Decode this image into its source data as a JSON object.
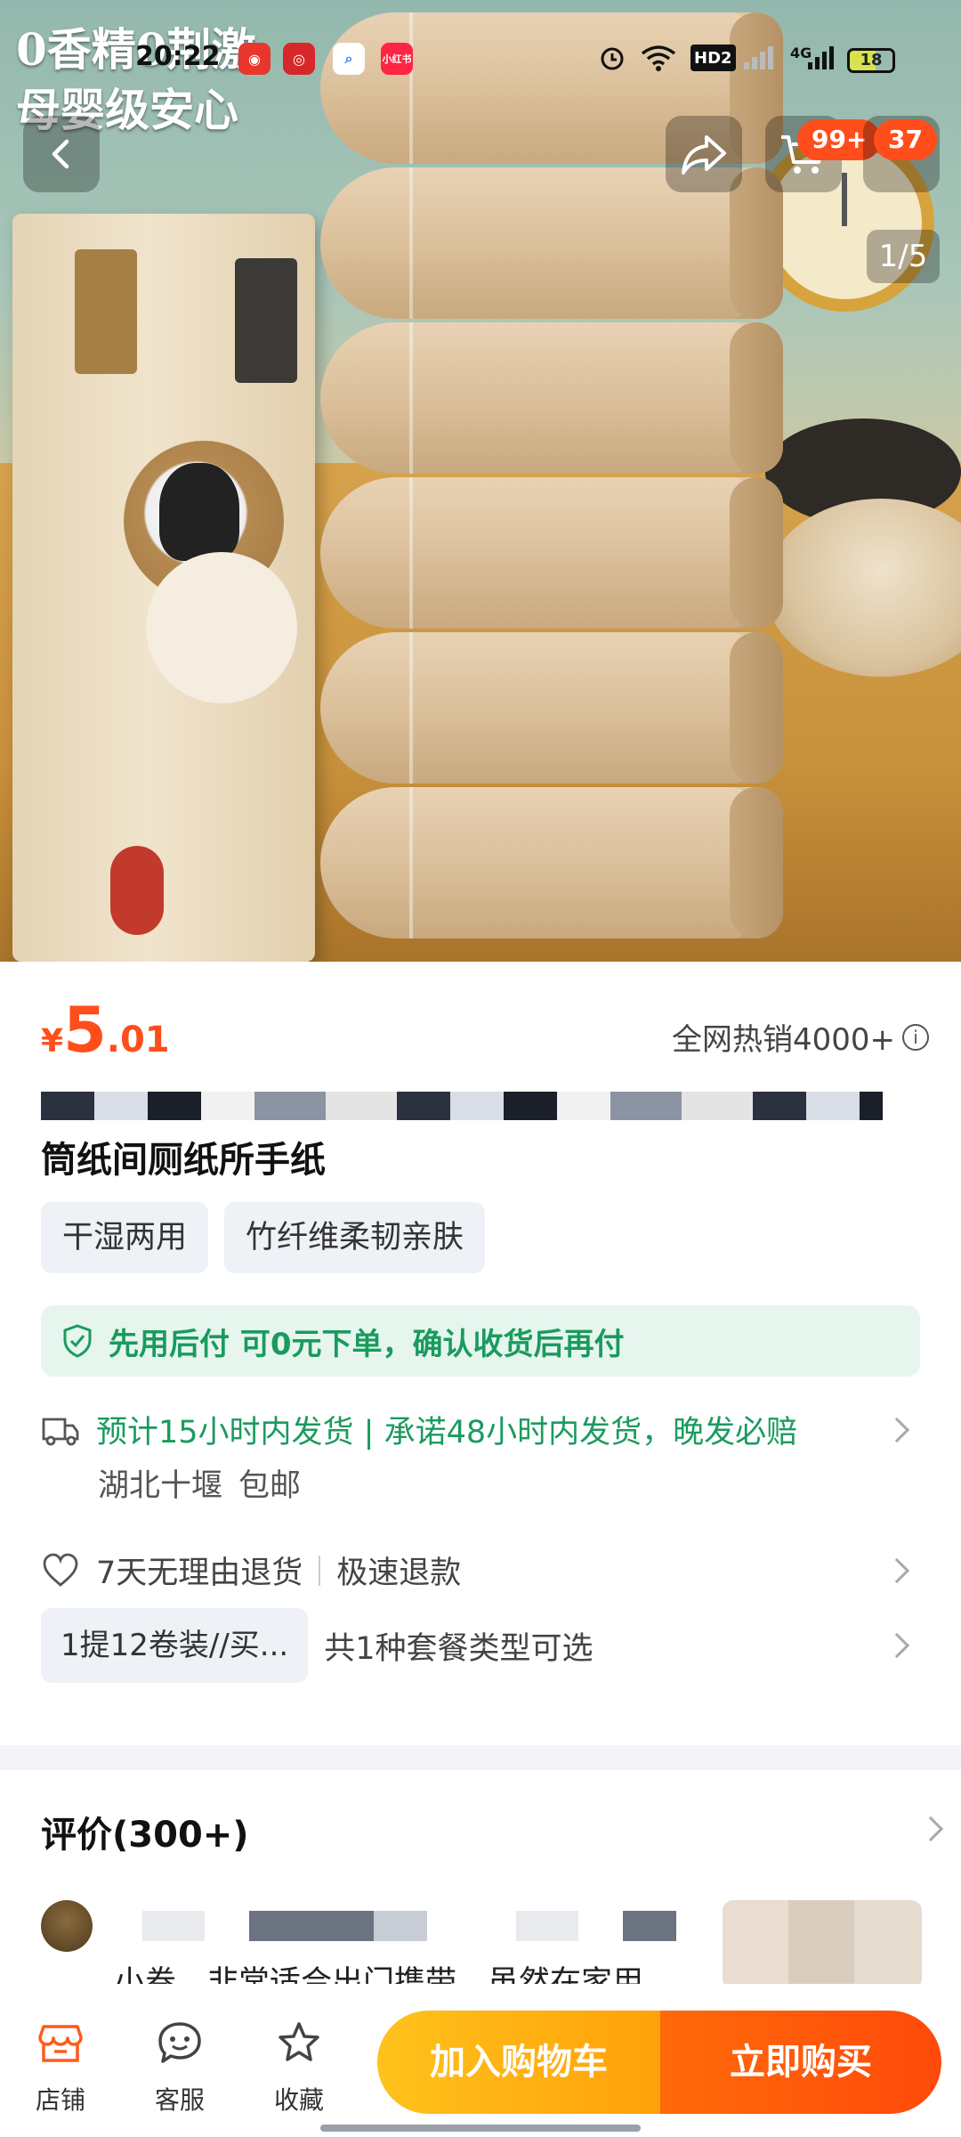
{
  "status_bar": {
    "time": "20:22",
    "app_icons": [
      "weibo-icon",
      "app-icon",
      "search-app-icon",
      "xiaohongshu-icon"
    ],
    "xiaohongshu_label": "小红书",
    "network_label": "HD2",
    "network_gen": "4G",
    "battery": "18"
  },
  "hero": {
    "caption_line1": "0香精0荆激",
    "caption_line2": "母婴级安心",
    "pager": "1/5",
    "cart_badge": "99+",
    "message_badge": "37"
  },
  "product": {
    "price_currency": "¥",
    "price_int": "5",
    "price_dec": ".01",
    "sales": "全网热销4000+",
    "title": "筒纸间厕纸所手纸",
    "tags": [
      "干湿两用",
      "竹纤维柔韧亲肤"
    ],
    "pay_later": "先用后付 可0元下单，确认收货后再付",
    "shipping": "预计15小时内发货 | 承诺48小时内发货，晚发必赔",
    "ship_from": "湖北十堰",
    "free_shipping": "包邮",
    "return_policy": "7天无理由退货",
    "refund": "极速退款",
    "package_chip": "1提12卷装//买...",
    "package_options": "共1种套餐类型可选"
  },
  "reviews": {
    "heading": "评价(300+)",
    "snippet": "小卷，非常适合出门携带。虽然在家用"
  },
  "bottom_bar": {
    "shop": "店铺",
    "service": "客服",
    "favorite": "收藏",
    "add_to_cart": "加入购物车",
    "buy_now": "立即购买"
  },
  "colors": {
    "accent_orange": "#ff4d1c",
    "green": "#1a9b5e",
    "cart_yellow": "#ffb315"
  }
}
